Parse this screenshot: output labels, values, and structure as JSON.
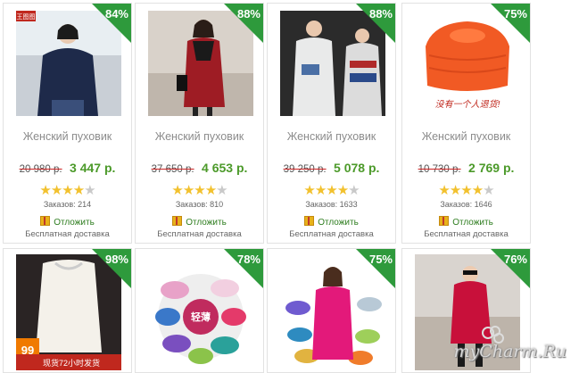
{
  "products_row1": [
    {
      "title": "Женский пуховик",
      "old_price": "20 980",
      "currency": " р.",
      "new_price": "3 447 р.",
      "discount": "84%",
      "rating": 4,
      "orders": "Заказов: 214",
      "later_label": "Отложить",
      "shipping": "Бесплатная доставка"
    },
    {
      "title": "Женский пуховик",
      "old_price": "37 650",
      "currency": " р.",
      "new_price": "4 653 р.",
      "discount": "88%",
      "rating": 4,
      "orders": "Заказов: 810",
      "later_label": "Отложить",
      "shipping": "Бесплатная доставка"
    },
    {
      "title": "Женский пуховик",
      "old_price": "39 250",
      "currency": " р.",
      "new_price": "5 078 р.",
      "discount": "88%",
      "rating": 4,
      "orders": "Заказов: 1633",
      "later_label": "Отложить",
      "shipping": "Бесплатная доставка"
    },
    {
      "title": "Женский пуховик",
      "old_price": "10 730",
      "currency": " р.",
      "new_price": "2 769 р.",
      "discount": "75%",
      "rating": 4,
      "orders": "Заказов: 1646",
      "later_label": "Отложить",
      "shipping": "Бесплатная доставка"
    }
  ],
  "products_row2": [
    {
      "discount": "98%"
    },
    {
      "discount": "78%"
    },
    {
      "discount": "75%"
    },
    {
      "discount": "76%"
    }
  ],
  "photo_overlays": {
    "p4_caption": "没有一个人退货!",
    "p5_badge": "99",
    "p5_banner": "现货72小时发货",
    "p6_center": "轻薄",
    "p1_logo": "王图图"
  },
  "watermark": "myCharm.Ru",
  "colors": {
    "badge": "#2e9a3c",
    "new_price": "#4c9a2a",
    "old_price": "#cc2222",
    "star": "#f2c12e"
  }
}
